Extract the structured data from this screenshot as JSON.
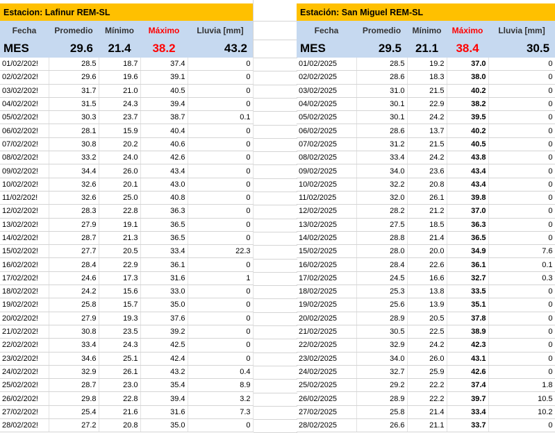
{
  "left": {
    "title": "Estacion: Lafinur REM-SL",
    "headers": [
      "Fecha",
      "Promedio",
      "Mínimo",
      "Máximo",
      "Lluvia [mm]"
    ],
    "summary": {
      "label": "MES",
      "promedio": "29.6",
      "minimo": "21.4",
      "maximo": "38.2",
      "lluvia": "43.2"
    },
    "rows": [
      [
        "01/02/202!",
        "28.5",
        "18.7",
        "37.4",
        "0"
      ],
      [
        "02/02/202!",
        "29.6",
        "19.6",
        "39.1",
        "0"
      ],
      [
        "03/02/202!",
        "31.7",
        "21.0",
        "40.5",
        "0"
      ],
      [
        "04/02/202!",
        "31.5",
        "24.3",
        "39.4",
        "0"
      ],
      [
        "05/02/202!",
        "30.3",
        "23.7",
        "38.7",
        "0.1"
      ],
      [
        "06/02/202!",
        "28.1",
        "15.9",
        "40.4",
        "0"
      ],
      [
        "07/02/202!",
        "30.8",
        "20.2",
        "40.6",
        "0"
      ],
      [
        "08/02/202!",
        "33.2",
        "24.0",
        "42.6",
        "0"
      ],
      [
        "09/02/202!",
        "34.4",
        "26.0",
        "43.4",
        "0"
      ],
      [
        "10/02/202!",
        "32.6",
        "20.1",
        "43.0",
        "0"
      ],
      [
        "11/02/202!",
        "32.6",
        "25.0",
        "40.8",
        "0"
      ],
      [
        "12/02/202!",
        "28.3",
        "22.8",
        "36.3",
        "0"
      ],
      [
        "13/02/202!",
        "27.9",
        "19.1",
        "36.5",
        "0"
      ],
      [
        "14/02/202!",
        "28.7",
        "21.3",
        "36.5",
        "0"
      ],
      [
        "15/02/202!",
        "27.7",
        "20.5",
        "33.4",
        "22.3"
      ],
      [
        "16/02/202!",
        "28.4",
        "22.9",
        "36.1",
        "0"
      ],
      [
        "17/02/202!",
        "24.6",
        "17.3",
        "31.6",
        "1"
      ],
      [
        "18/02/202!",
        "24.2",
        "15.6",
        "33.0",
        "0"
      ],
      [
        "19/02/202!",
        "25.8",
        "15.7",
        "35.0",
        "0"
      ],
      [
        "20/02/202!",
        "27.9",
        "19.3",
        "37.6",
        "0"
      ],
      [
        "21/02/202!",
        "30.8",
        "23.5",
        "39.2",
        "0"
      ],
      [
        "22/02/202!",
        "33.4",
        "24.3",
        "42.5",
        "0"
      ],
      [
        "23/02/202!",
        "34.6",
        "25.1",
        "42.4",
        "0"
      ],
      [
        "24/02/202!",
        "32.9",
        "26.1",
        "43.2",
        "0.4"
      ],
      [
        "25/02/202!",
        "28.7",
        "23.0",
        "35.4",
        "8.9"
      ],
      [
        "26/02/202!",
        "29.8",
        "22.8",
        "39.4",
        "3.2"
      ],
      [
        "27/02/202!",
        "25.4",
        "21.6",
        "31.6",
        "7.3"
      ],
      [
        "28/02/202!",
        "27.2",
        "20.8",
        "35.0",
        "0"
      ]
    ]
  },
  "right": {
    "title": "Estación: San Miguel REM-SL",
    "headers": [
      "Fecha",
      "Promedio",
      "Mínimo",
      "Máximo",
      "Lluvia [mm]"
    ],
    "summary": {
      "label": "MES",
      "promedio": "29.5",
      "minimo": "21.1",
      "maximo": "38.4",
      "lluvia": "30.5"
    },
    "rows": [
      [
        "01/02/2025",
        "28.5",
        "19.2",
        "37.0",
        "0"
      ],
      [
        "02/02/2025",
        "28.6",
        "18.3",
        "38.0",
        "0"
      ],
      [
        "03/02/2025",
        "31.0",
        "21.5",
        "40.2",
        "0"
      ],
      [
        "04/02/2025",
        "30.1",
        "22.9",
        "38.2",
        "0"
      ],
      [
        "05/02/2025",
        "30.1",
        "24.2",
        "39.5",
        "0"
      ],
      [
        "06/02/2025",
        "28.6",
        "13.7",
        "40.2",
        "0"
      ],
      [
        "07/02/2025",
        "31.2",
        "21.5",
        "40.5",
        "0"
      ],
      [
        "08/02/2025",
        "33.4",
        "24.2",
        "43.8",
        "0"
      ],
      [
        "09/02/2025",
        "34.0",
        "23.6",
        "43.4",
        "0"
      ],
      [
        "10/02/2025",
        "32.2",
        "20.8",
        "43.4",
        "0"
      ],
      [
        "11/02/2025",
        "32.0",
        "26.1",
        "39.8",
        "0"
      ],
      [
        "12/02/2025",
        "28.2",
        "21.2",
        "37.0",
        "0"
      ],
      [
        "13/02/2025",
        "27.5",
        "18.5",
        "36.3",
        "0"
      ],
      [
        "14/02/2025",
        "28.8",
        "21.4",
        "36.5",
        "0"
      ],
      [
        "15/02/2025",
        "28.0",
        "20.0",
        "34.9",
        "7.6"
      ],
      [
        "16/02/2025",
        "28.4",
        "22.6",
        "36.1",
        "0.1"
      ],
      [
        "17/02/2025",
        "24.5",
        "16.6",
        "32.7",
        "0.3"
      ],
      [
        "18/02/2025",
        "25.3",
        "13.8",
        "33.5",
        "0"
      ],
      [
        "19/02/2025",
        "25.6",
        "13.9",
        "35.1",
        "0"
      ],
      [
        "20/02/2025",
        "28.9",
        "20.5",
        "37.8",
        "0"
      ],
      [
        "21/02/2025",
        "30.5",
        "22.5",
        "38.9",
        "0"
      ],
      [
        "22/02/2025",
        "32.9",
        "24.2",
        "42.3",
        "0"
      ],
      [
        "23/02/2025",
        "34.0",
        "26.0",
        "43.1",
        "0"
      ],
      [
        "24/02/2025",
        "32.7",
        "25.9",
        "42.6",
        "0"
      ],
      [
        "25/02/2025",
        "29.2",
        "22.2",
        "37.4",
        "1.8"
      ],
      [
        "26/02/2025",
        "28.9",
        "22.2",
        "39.7",
        "10.5"
      ],
      [
        "27/02/2025",
        "25.8",
        "21.4",
        "33.4",
        "10.2"
      ],
      [
        "28/02/2025",
        "26.6",
        "21.1",
        "33.7",
        "0"
      ]
    ]
  },
  "colors": {
    "title_bg": "#ffc000",
    "header_bg": "#c6d9f0",
    "max_text": "#ff0000"
  }
}
